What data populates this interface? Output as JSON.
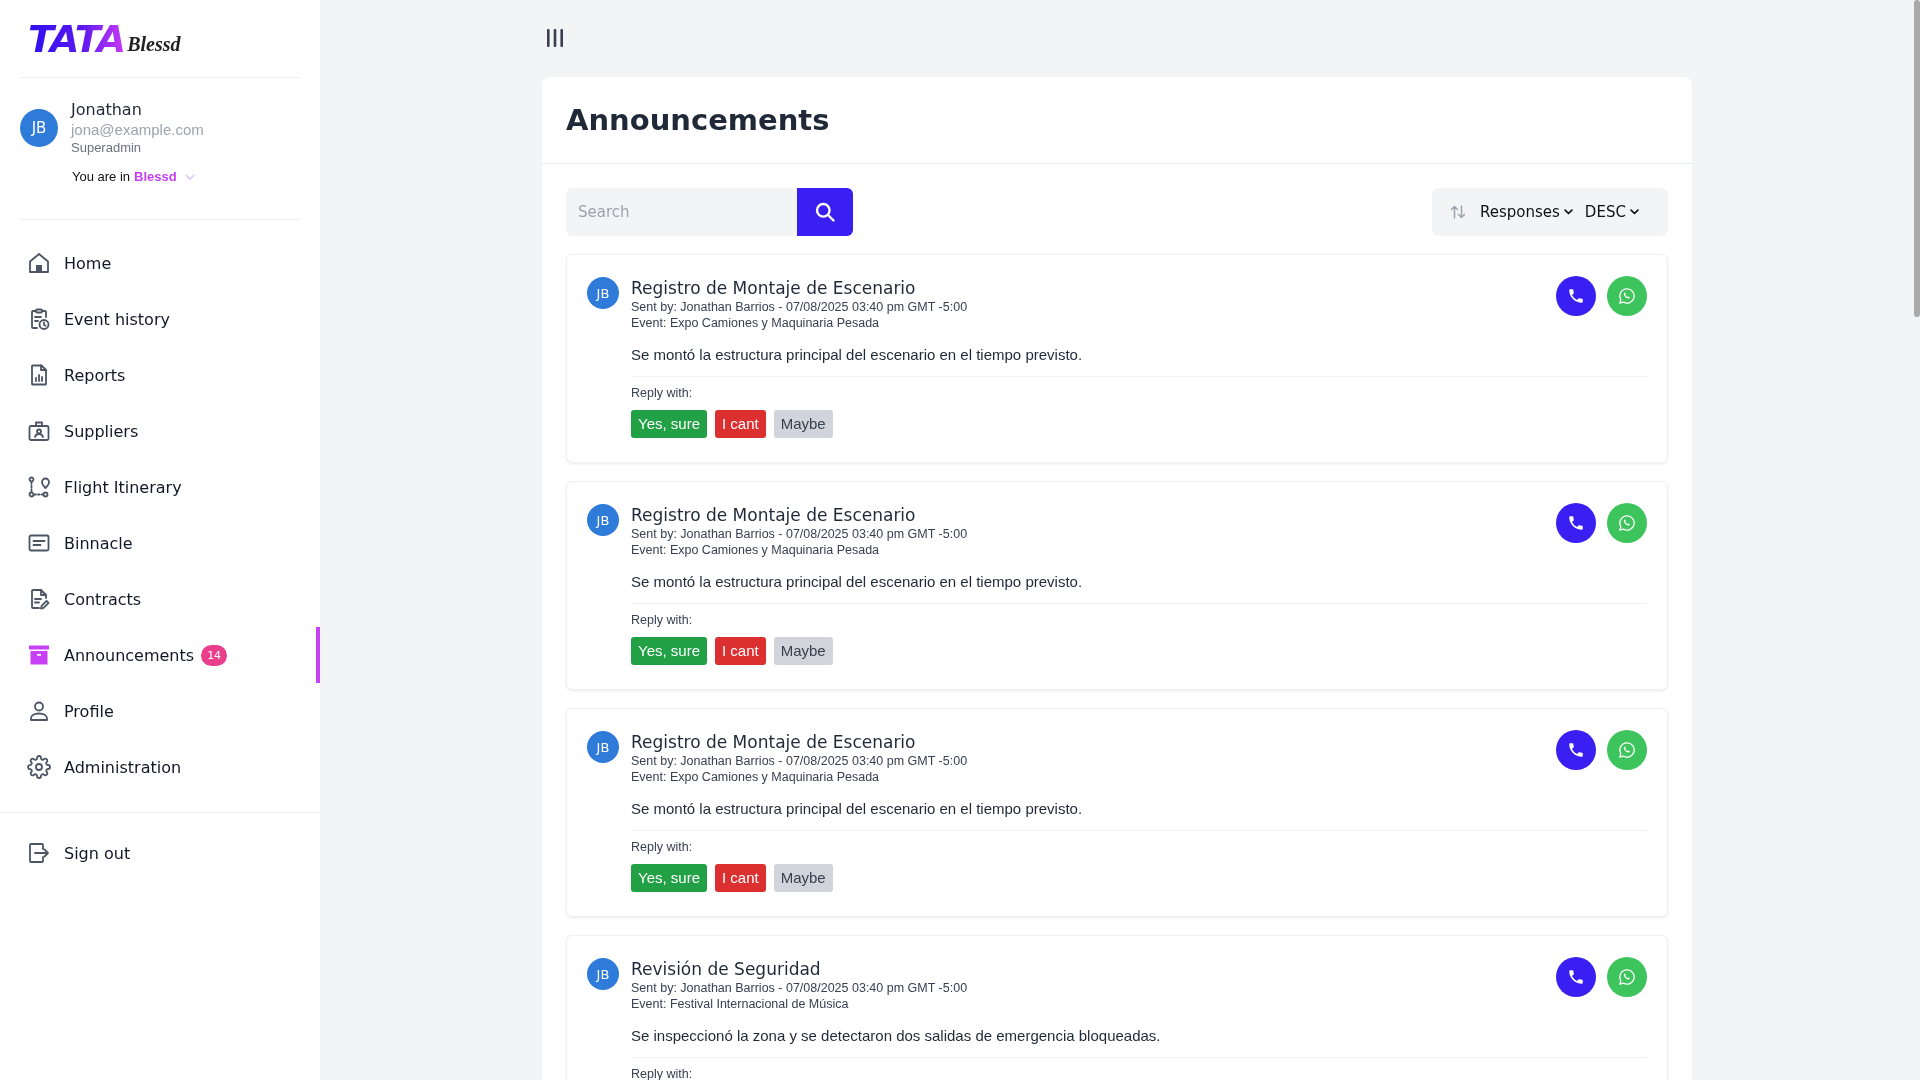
{
  "logo": {
    "wordmark": "TATA",
    "script": "Blessd"
  },
  "user": {
    "initials": "JB",
    "name": "Jonathan",
    "email": "jona@example.com",
    "role": "Superadmin",
    "context_label": "You are in",
    "context_value": "Blessd"
  },
  "nav": [
    {
      "label": "Home",
      "selected": false
    },
    {
      "label": "Event history",
      "selected": false
    },
    {
      "label": "Reports",
      "selected": false
    },
    {
      "label": "Suppliers",
      "selected": false
    },
    {
      "label": "Flight Itinerary",
      "selected": false
    },
    {
      "label": "Binnacle",
      "selected": false
    },
    {
      "label": "Contracts",
      "selected": false
    },
    {
      "label": "Announcements",
      "selected": true,
      "badge": "14"
    },
    {
      "label": "Profile",
      "selected": false
    },
    {
      "label": "Administration",
      "selected": false
    }
  ],
  "sign_out": {
    "label": "Sign out"
  },
  "page": {
    "title": "Announcements"
  },
  "search": {
    "placeholder": "Search"
  },
  "sort": {
    "field": "Responses",
    "order": "DESC"
  },
  "announcements": [
    {
      "initials": "JB",
      "title": "Registro de Montaje de Escenario",
      "sent_by": "Sent by: Jonathan Barrios - 07/08/2025 03:40 pm GMT -5:00",
      "event": "Event: Expo Camiones y Maquinaria Pesada",
      "body": "Se montó la estructura principal del escenario en el tiempo previsto.",
      "reply_label": "Reply with:",
      "replies": [
        {
          "label": "Yes, sure",
          "kind": "accept"
        },
        {
          "label": "I cant",
          "kind": "decline"
        },
        {
          "label": "Maybe",
          "kind": "maybe"
        }
      ]
    },
    {
      "initials": "JB",
      "title": "Registro de Montaje de Escenario",
      "sent_by": "Sent by: Jonathan Barrios - 07/08/2025 03:40 pm GMT -5:00",
      "event": "Event: Expo Camiones y Maquinaria Pesada",
      "body": "Se montó la estructura principal del escenario en el tiempo previsto.",
      "reply_label": "Reply with:",
      "replies": [
        {
          "label": "Yes, sure",
          "kind": "accept"
        },
        {
          "label": "I cant",
          "kind": "decline"
        },
        {
          "label": "Maybe",
          "kind": "maybe"
        }
      ]
    },
    {
      "initials": "JB",
      "title": "Registro de Montaje de Escenario",
      "sent_by": "Sent by: Jonathan Barrios - 07/08/2025 03:40 pm GMT -5:00",
      "event": "Event: Expo Camiones y Maquinaria Pesada",
      "body": "Se montó la estructura principal del escenario en el tiempo previsto.",
      "reply_label": "Reply with:",
      "replies": [
        {
          "label": "Yes, sure",
          "kind": "accept"
        },
        {
          "label": "I cant",
          "kind": "decline"
        },
        {
          "label": "Maybe",
          "kind": "maybe"
        }
      ]
    },
    {
      "initials": "JB",
      "title": "Revisión de Seguridad",
      "sent_by": "Sent by: Jonathan Barrios - 07/08/2025 03:40 pm GMT -5:00",
      "event": "Event: Festival Internacional de Música",
      "body": "Se inspeccionó la zona y se detectaron dos salidas de emergencia bloqueadas.",
      "reply_label": "Reply with:"
    }
  ]
}
